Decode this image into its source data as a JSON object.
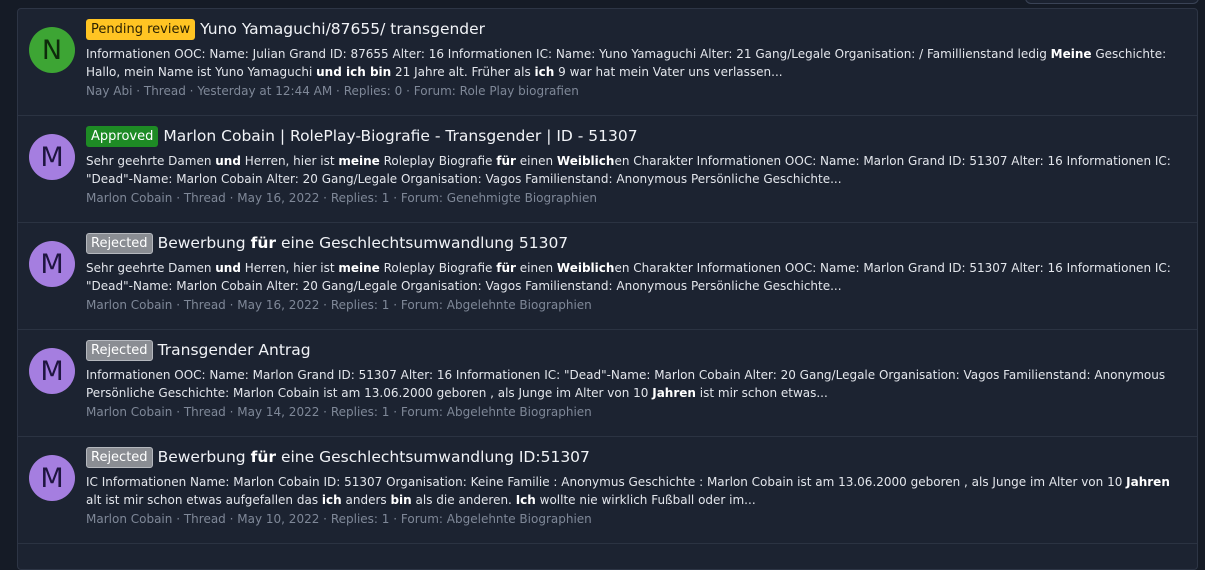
{
  "results": [
    {
      "avatar_letter": "N",
      "avatar_color": "#3da534",
      "badge": "Pending review",
      "badge_type": "pending",
      "title_parts": [
        {
          "t": "Yuno Yamaguchi/87655/ transgender",
          "b": false
        }
      ],
      "snippet_parts": [
        {
          "t": "Informationen OOC: Name: Julian Grand ID: 87655 Alter: 16 Informationen IC: Name: Yuno Yamaguchi Alter: 21 Gang/Legale Organisation: / Famillienstand ledig ",
          "b": false
        },
        {
          "t": "Meine",
          "b": true
        },
        {
          "t": " Geschichte: Hallo, mein Name ist Yuno Yamaguchi ",
          "b": false
        },
        {
          "t": "und ich bin",
          "b": true
        },
        {
          "t": " 21 Jahre alt. Früher als ",
          "b": false
        },
        {
          "t": "ich",
          "b": true
        },
        {
          "t": " 9 war hat mein Vater uns verlassen...",
          "b": false
        }
      ],
      "author": "Nay Abi",
      "content_type": "Thread",
      "date": "Yesterday at 12:44 AM",
      "replies": "Replies: 0",
      "forum": "Forum: Role Play biografien"
    },
    {
      "avatar_letter": "M",
      "avatar_color": "#a57ee0",
      "badge": "Approved",
      "badge_type": "approved",
      "title_parts": [
        {
          "t": "Marlon Cobain | RolePlay-Biografie - Transgender | ID - 51307",
          "b": false
        }
      ],
      "snippet_parts": [
        {
          "t": "Sehr geehrte Damen ",
          "b": false
        },
        {
          "t": "und",
          "b": true
        },
        {
          "t": " Herren, hier ist ",
          "b": false
        },
        {
          "t": "meine",
          "b": true
        },
        {
          "t": " Roleplay Biografie ",
          "b": false
        },
        {
          "t": "für",
          "b": true
        },
        {
          "t": " einen ",
          "b": false
        },
        {
          "t": "Weiblich",
          "b": true
        },
        {
          "t": "en Charakter Informationen OOC: Name: Marlon Grand ID: 51307 Alter: 16 Informationen IC: \"Dead\"-Name: Marlon Cobain Alter: 20 Gang/Legale Organisation: Vagos Familienstand: Anonymous Persönliche Geschichte...",
          "b": false
        }
      ],
      "author": "Marlon Cobain",
      "content_type": "Thread",
      "date": "May 16, 2022",
      "replies": "Replies: 1",
      "forum": "Forum: Genehmigte Biographien"
    },
    {
      "avatar_letter": "M",
      "avatar_color": "#a57ee0",
      "badge": "Rejected",
      "badge_type": "rejected",
      "title_parts": [
        {
          "t": "Bewerbung ",
          "b": false
        },
        {
          "t": "für",
          "b": true
        },
        {
          "t": " eine Geschlechtsumwandlung 51307",
          "b": false
        }
      ],
      "snippet_parts": [
        {
          "t": "Sehr geehrte Damen ",
          "b": false
        },
        {
          "t": "und",
          "b": true
        },
        {
          "t": " Herren, hier ist ",
          "b": false
        },
        {
          "t": "meine",
          "b": true
        },
        {
          "t": " Roleplay Biografie ",
          "b": false
        },
        {
          "t": "für",
          "b": true
        },
        {
          "t": " einen ",
          "b": false
        },
        {
          "t": "Weiblich",
          "b": true
        },
        {
          "t": "en Charakter Informationen OOC: Name: Marlon Grand ID: 51307 Alter: 16 Informationen IC: \"Dead\"-Name: Marlon Cobain Alter: 20 Gang/Legale Organisation: Vagos Familienstand: Anonymous Persönliche Geschichte...",
          "b": false
        }
      ],
      "author": "Marlon Cobain",
      "content_type": "Thread",
      "date": "May 16, 2022",
      "replies": "Replies: 1",
      "forum": "Forum: Abgelehnte Biographien"
    },
    {
      "avatar_letter": "M",
      "avatar_color": "#a57ee0",
      "badge": "Rejected",
      "badge_type": "rejected",
      "title_parts": [
        {
          "t": "Transgender Antrag",
          "b": false
        }
      ],
      "snippet_parts": [
        {
          "t": "Informationen OOC: Name: Marlon Grand ID: 51307 Alter: 16 Informationen IC: \"Dead\"-Name: Marlon Cobain Alter: 20 Gang/Legale Organisation: Vagos Familienstand: Anonymous Persönliche Geschichte: Marlon Cobain ist am 13.06.2000 geboren , als Junge im Alter von 10 ",
          "b": false
        },
        {
          "t": "Jahren",
          "b": true
        },
        {
          "t": " ist mir schon etwas...",
          "b": false
        }
      ],
      "author": "Marlon Cobain",
      "content_type": "Thread",
      "date": "May 14, 2022",
      "replies": "Replies: 1",
      "forum": "Forum: Abgelehnte Biographien"
    },
    {
      "avatar_letter": "M",
      "avatar_color": "#a57ee0",
      "badge": "Rejected",
      "badge_type": "rejected",
      "title_parts": [
        {
          "t": "Bewerbung ",
          "b": false
        },
        {
          "t": "für",
          "b": true
        },
        {
          "t": " eine Geschlechtsumwandlung ID:51307",
          "b": false
        }
      ],
      "snippet_parts": [
        {
          "t": "IC Informationen Name: Marlon Cobain ID: 51307 Organisation: Keine Familie : Anonymus Geschichte : Marlon Cobain ist am 13.06.2000 geboren , als Junge im Alter von 10 ",
          "b": false
        },
        {
          "t": "Jahren",
          "b": true
        },
        {
          "t": " alt ist mir schon etwas aufgefallen das ",
          "b": false
        },
        {
          "t": "ich",
          "b": true
        },
        {
          "t": " anders ",
          "b": false
        },
        {
          "t": "bin",
          "b": true
        },
        {
          "t": " als die anderen. ",
          "b": false
        },
        {
          "t": "Ich",
          "b": true
        },
        {
          "t": " wollte nie wirklich Fußball oder im...",
          "b": false
        }
      ],
      "author": "Marlon Cobain",
      "content_type": "Thread",
      "date": "May 10, 2022",
      "replies": "Replies: 1",
      "forum": "Forum: Abgelehnte Biographien"
    }
  ]
}
